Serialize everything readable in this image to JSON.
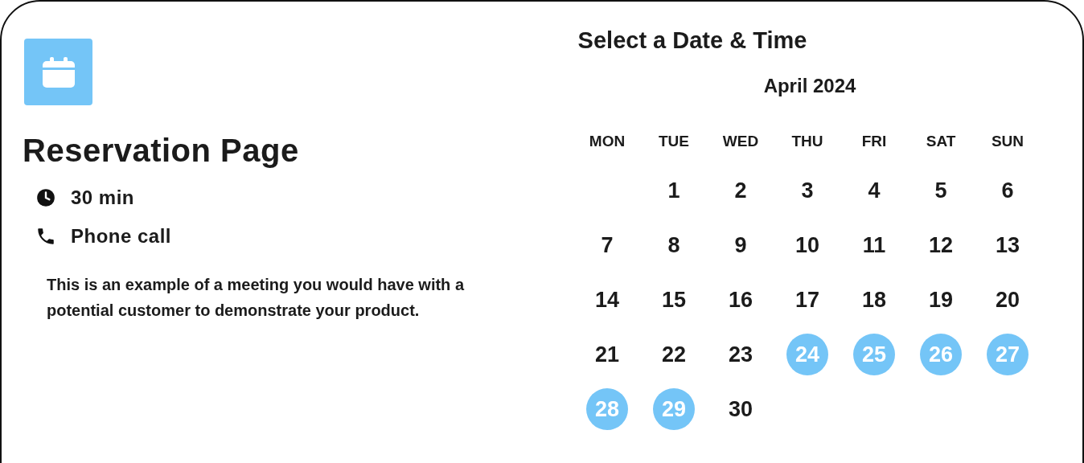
{
  "event": {
    "title": "Reservation Page",
    "details": [
      {
        "kind": "duration",
        "text": "30 min"
      },
      {
        "kind": "phone",
        "text": "Phone call"
      }
    ],
    "description": "This is an example of a meeting you would have with a potential customer to demonstrate your product."
  },
  "calendar": {
    "title": "Select a Date & Time",
    "month": "April 2024",
    "weekdays": [
      "MON",
      "TUE",
      "WED",
      "THU",
      "FRI",
      "SAT",
      "SUN"
    ],
    "weeks": [
      [
        {
          "day": "1",
          "available": false
        },
        {
          "day": "2",
          "available": false
        },
        {
          "day": "3",
          "available": false
        },
        {
          "day": "4",
          "available": false
        },
        {
          "day": "5",
          "available": false
        },
        {
          "day": "6",
          "available": false
        }
      ],
      [
        {
          "day": "7",
          "available": false
        },
        {
          "day": "8",
          "available": false
        },
        {
          "day": "9",
          "available": false
        },
        {
          "day": "10",
          "available": false
        },
        {
          "day": "11",
          "available": false
        },
        {
          "day": "12",
          "available": false
        },
        {
          "day": "13",
          "available": false
        }
      ],
      [
        {
          "day": "14",
          "available": false
        },
        {
          "day": "15",
          "available": false
        },
        {
          "day": "16",
          "available": false
        },
        {
          "day": "17",
          "available": false
        },
        {
          "day": "18",
          "available": false
        },
        {
          "day": "19",
          "available": false
        },
        {
          "day": "20",
          "available": false
        }
      ],
      [
        {
          "day": "21",
          "available": false
        },
        {
          "day": "22",
          "available": false
        },
        {
          "day": "23",
          "available": false
        },
        {
          "day": "24",
          "available": true
        },
        {
          "day": "25",
          "available": true
        },
        {
          "day": "26",
          "available": true
        },
        {
          "day": "27",
          "available": true
        }
      ],
      [
        {
          "day": "28",
          "available": true
        },
        {
          "day": "29",
          "available": true
        },
        {
          "day": "30",
          "available": false
        }
      ]
    ]
  }
}
